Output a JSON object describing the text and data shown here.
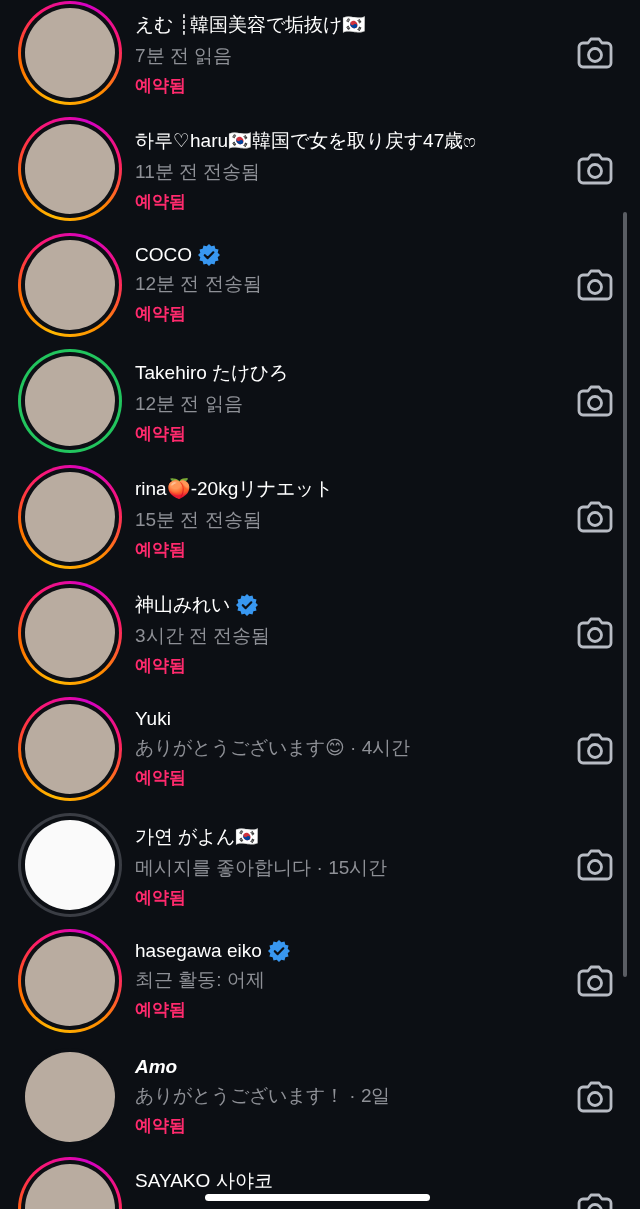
{
  "threads": [
    {
      "name": "えむ ┊韓国美容で垢抜け🇰🇷",
      "verified": false,
      "emphasized": false,
      "story": true,
      "close_friends": false,
      "seen": false,
      "status": "7분 전 읽음",
      "note": "예약됨"
    },
    {
      "name": "하루♡haru🇰🇷韓国で女を取り戻す47歳ෆ",
      "verified": false,
      "emphasized": false,
      "story": true,
      "close_friends": false,
      "seen": false,
      "status": "11분 전 전송됨",
      "note": "예약됨"
    },
    {
      "name": "COCO",
      "verified": true,
      "emphasized": false,
      "story": true,
      "close_friends": false,
      "seen": false,
      "status": "12분 전 전송됨",
      "note": "예약됨"
    },
    {
      "name": "Takehiro たけひろ",
      "verified": false,
      "emphasized": false,
      "story": true,
      "close_friends": true,
      "seen": false,
      "status": "12분 전 읽음",
      "note": "예약됨"
    },
    {
      "name": "rina🍑-20kgリナエット",
      "verified": false,
      "emphasized": false,
      "story": true,
      "close_friends": false,
      "seen": false,
      "status": "15분 전 전송됨",
      "note": "예약됨"
    },
    {
      "name": "神山みれい",
      "verified": true,
      "emphasized": false,
      "story": true,
      "close_friends": false,
      "seen": false,
      "status": "3시간 전 전송됨",
      "note": "예약됨"
    },
    {
      "name": "Yuki",
      "verified": false,
      "emphasized": false,
      "story": true,
      "close_friends": false,
      "seen": false,
      "status": "ありがとうございます😊 · 4시간",
      "note": "예약됨"
    },
    {
      "name": "가연 がよん🇰🇷",
      "verified": false,
      "emphasized": false,
      "story": true,
      "close_friends": false,
      "seen": true,
      "status": "메시지를 좋아합니다 · 15시간",
      "note": "예약됨"
    },
    {
      "name": "hasegawa eiko",
      "verified": true,
      "emphasized": false,
      "story": true,
      "close_friends": false,
      "seen": false,
      "status": "최근 활동: 어제",
      "note": "예약됨"
    },
    {
      "name": "Amo",
      "verified": false,
      "emphasized": true,
      "story": false,
      "close_friends": false,
      "seen": false,
      "status": "ありがとうございます！ · 2일",
      "note": "예약됨"
    },
    {
      "name": "SAYAKO 사야코",
      "verified": false,
      "emphasized": false,
      "story": true,
      "close_friends": false,
      "seen": false
    }
  ]
}
